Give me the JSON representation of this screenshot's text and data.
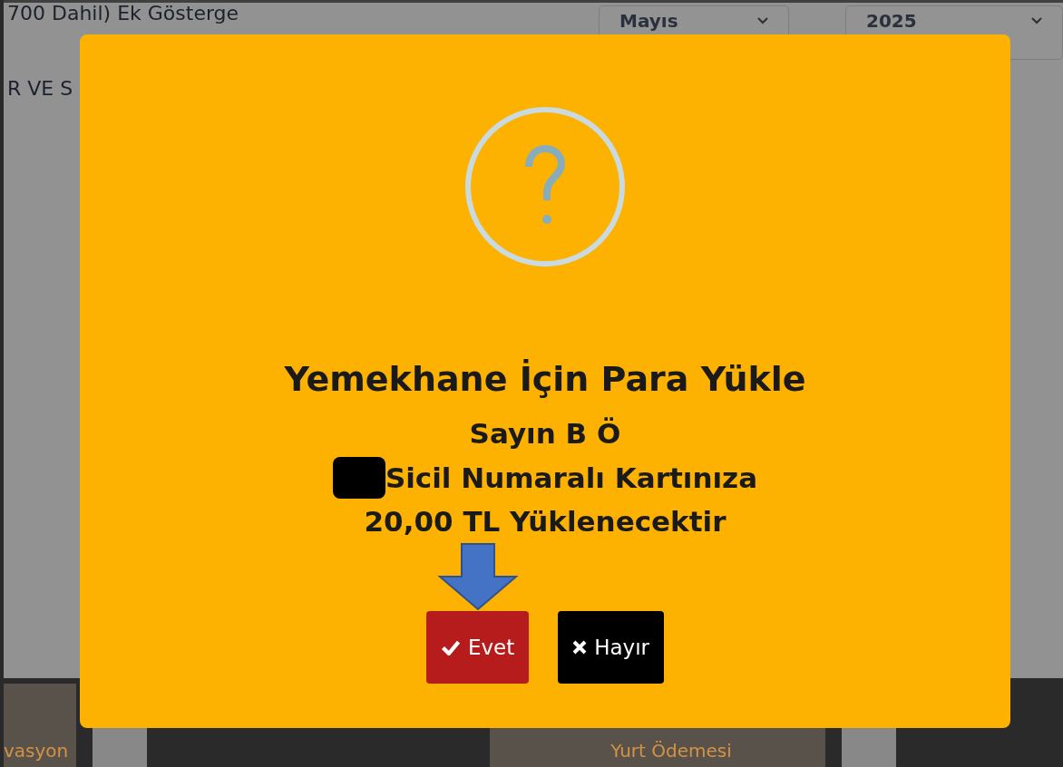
{
  "background": {
    "heading": "700 Dahil) Ek Gösterge",
    "section_label": "R VE S",
    "month_select": {
      "value": "Mayıs"
    },
    "year_select": {
      "value": "2025"
    },
    "tiles": [
      {
        "label": "vasyon"
      },
      {
        "label": "Yurt Ödemesi"
      }
    ]
  },
  "dialog": {
    "title": "Yemekhane İçin Para Yükle",
    "lines": [
      {
        "text": "Sayın B Ö",
        "redacted": false
      },
      {
        "text": "Sicil Numaralı Kartınıza",
        "redacted": true
      },
      {
        "text": "20,00 TL Yüklenecektir",
        "redacted": false
      }
    ],
    "buttons": [
      {
        "kind": "confirm",
        "label": "Evet",
        "pointed": true
      },
      {
        "kind": "cancel",
        "label": "Hayır",
        "pointed": false
      }
    ]
  }
}
